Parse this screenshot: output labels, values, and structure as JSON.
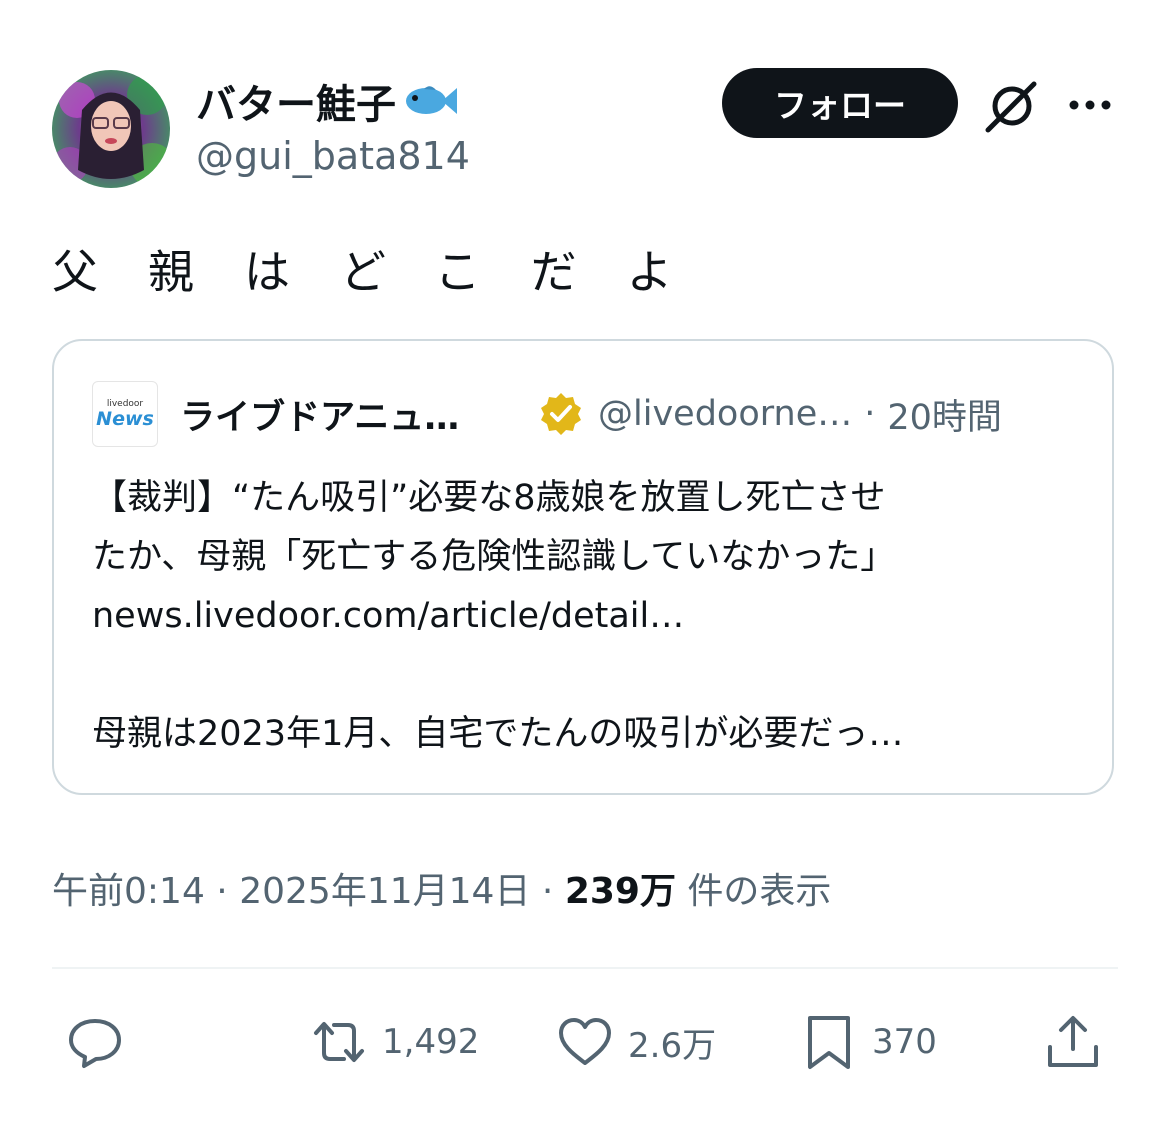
{
  "author": {
    "display_name": "バター鮭子",
    "handle": "@gui_bata814"
  },
  "follow_label": "フォロー",
  "tweet_text": "父親はどこだよ",
  "quote": {
    "logo_small": "livedoor",
    "logo_big": "News",
    "name": "ライブドアニュ…",
    "handle": "@livedoorne…",
    "separator": "·",
    "time": "20時間",
    "lines": [
      "【裁判】“たん吸引”必要な8歳娘を放置し死亡させ",
      "たか、母親「死亡する危険性認識していなかった」",
      "news.livedoor.com/article/detail…",
      "",
      "母親は2023年1月、自宅でたんの吸引が必要だっ…"
    ]
  },
  "meta": {
    "time": "午前0:14",
    "separator": "·",
    "date": "2025年11月14日",
    "views_count": "239万",
    "views_label": "件の表示"
  },
  "actions": {
    "reply_icon": "reply-icon",
    "retweets": "1,492",
    "likes": "2.6万",
    "bookmarks": "370",
    "share_icon": "share-icon"
  },
  "colors": {
    "text_primary": "#0f1419",
    "text_secondary": "#536471",
    "border": "#cfd9de",
    "verified_gold": "#e2b719",
    "fish_blue": "#4aa8e0"
  }
}
